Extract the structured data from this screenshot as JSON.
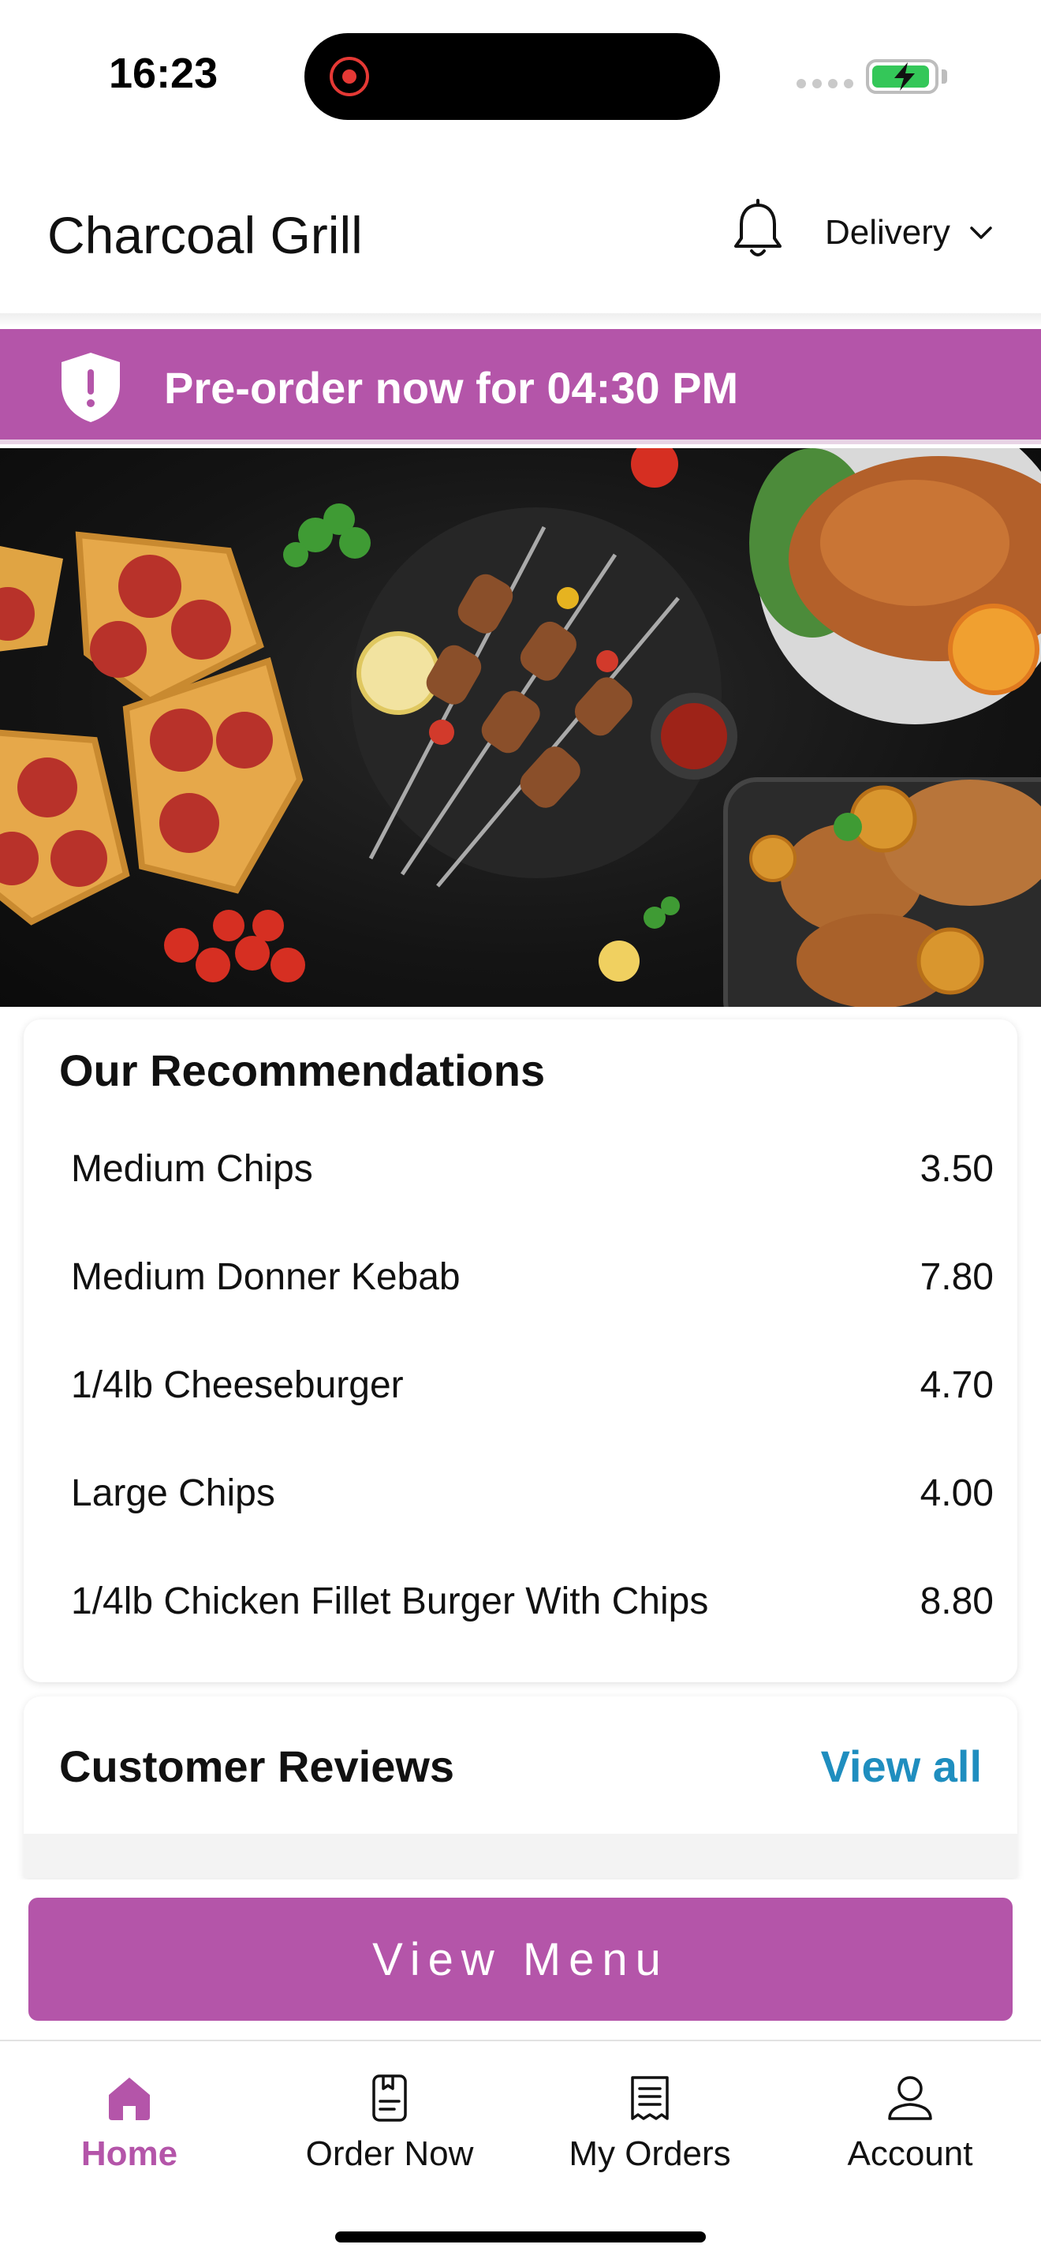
{
  "status_bar": {
    "time": "16:23"
  },
  "header": {
    "title": "Charcoal Grill",
    "bell_icon": "bell-icon",
    "order_type": "Delivery"
  },
  "banner": {
    "text": "Pre-order now for 04:30 PM",
    "icon": "shield-alert-icon",
    "color": "#b455a9"
  },
  "hero": {
    "description_icon": "food-hero-image"
  },
  "recommendations": {
    "title": "Our Recommendations",
    "items": [
      {
        "name": "Medium Chips",
        "price": "3.50"
      },
      {
        "name": "Medium Donner Kebab",
        "price": "7.80"
      },
      {
        "name": "1/4lb Cheeseburger",
        "price": "4.70"
      },
      {
        "name": "Large Chips",
        "price": "4.00"
      },
      {
        "name": "1/4lb Chicken Fillet Burger With Chips",
        "price": "8.80"
      }
    ]
  },
  "reviews": {
    "title": "Customer Reviews",
    "view_all": "View all",
    "link_color": "#1f8ebf"
  },
  "cta": {
    "label": "View Menu"
  },
  "tabs": [
    {
      "label": "Home",
      "icon": "home-icon",
      "active": true
    },
    {
      "label": "Order Now",
      "icon": "order-icon",
      "active": false
    },
    {
      "label": "My Orders",
      "icon": "receipt-icon",
      "active": false
    },
    {
      "label": "Account",
      "icon": "user-icon",
      "active": false
    }
  ]
}
